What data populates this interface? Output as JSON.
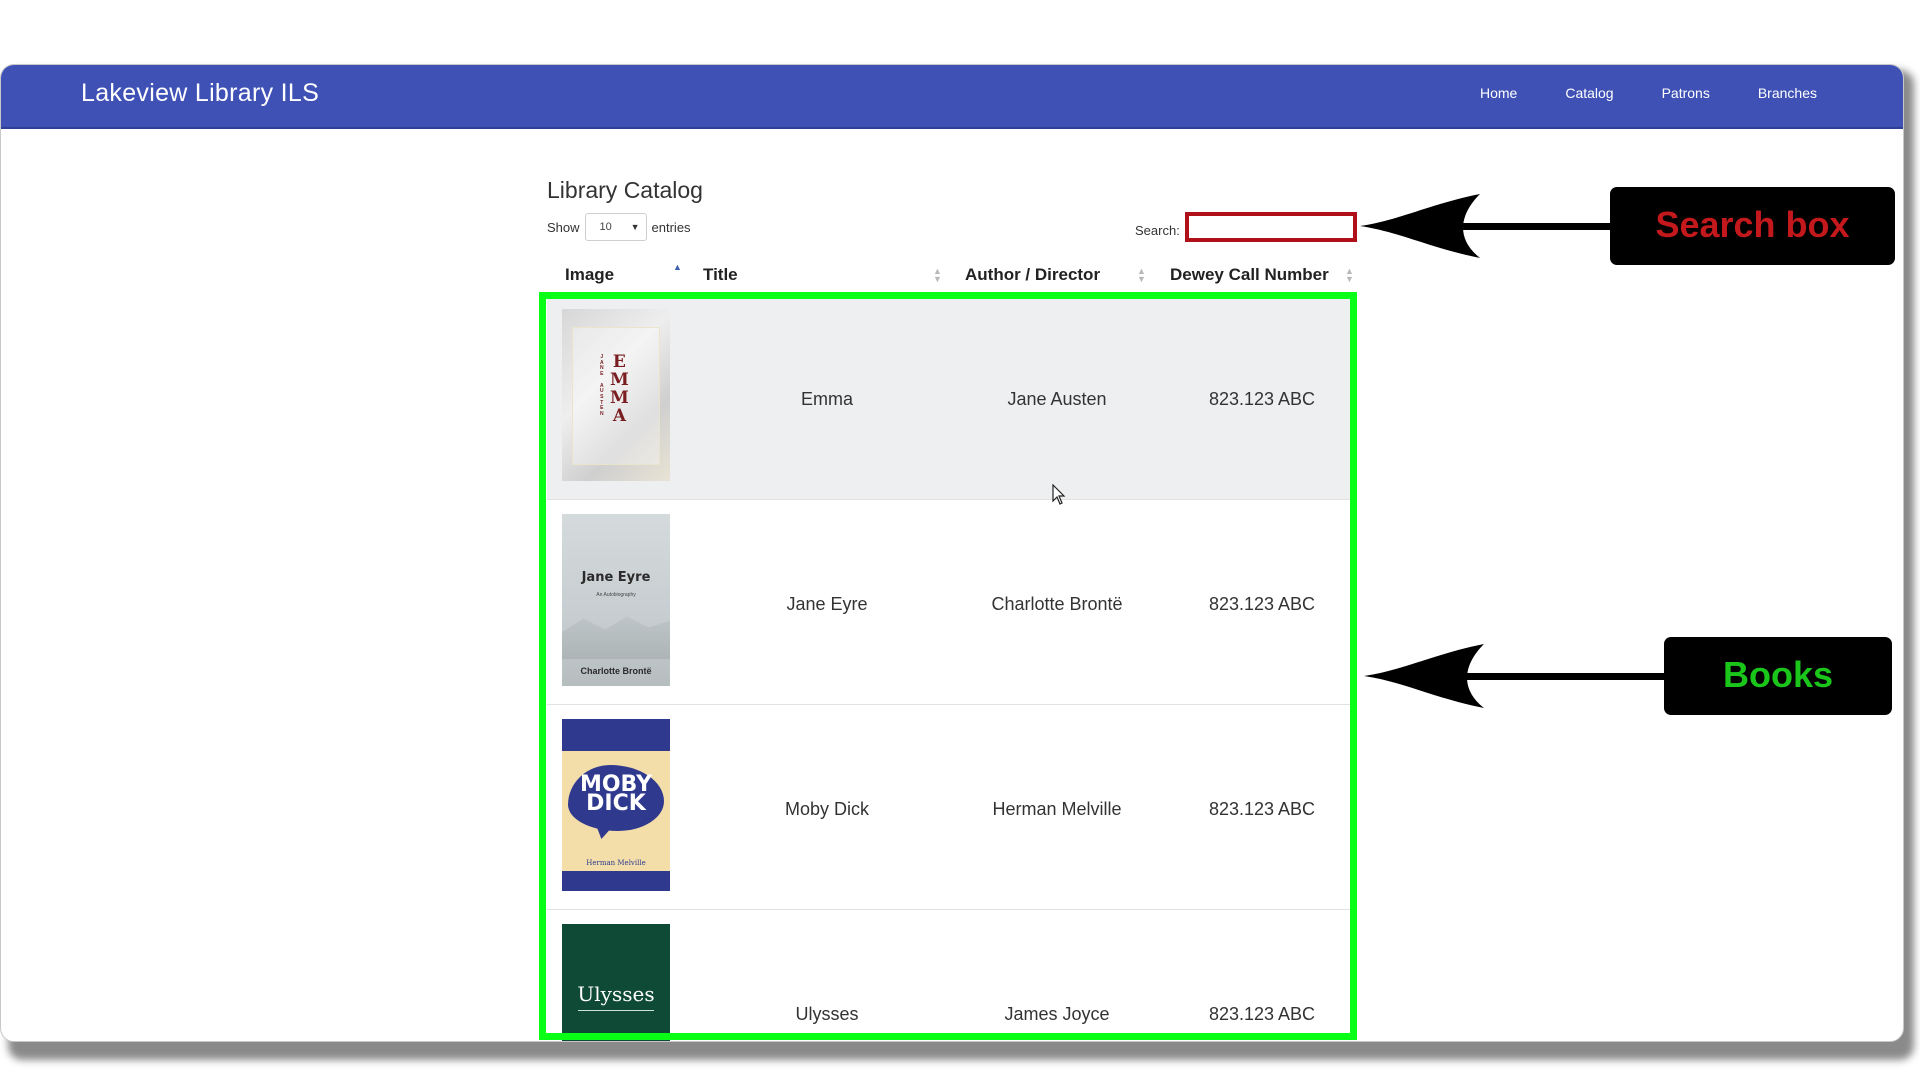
{
  "navbar": {
    "brand": "Lakeview Library ILS",
    "links": [
      "Home",
      "Catalog",
      "Patrons",
      "Branches"
    ]
  },
  "catalog": {
    "title": "Library Catalog",
    "show_label": "Show",
    "entries_value": "10",
    "entries_label": "entries",
    "search_label": "Search:",
    "search_value": ""
  },
  "table": {
    "headers": [
      "Image",
      "Title",
      "Author / Director",
      "Dewey Call Number"
    ],
    "rows": [
      {
        "cover": "EMMA",
        "cover_author": "JANE AUSTEN",
        "title": "Emma",
        "author": "Jane Austen",
        "dewey": "823.123 ABC"
      },
      {
        "cover": "Jane Eyre",
        "cover_subtitle": "An Autobiography",
        "cover_author": "Charlotte Brontë",
        "title": "Jane Eyre",
        "author": "Charlotte Brontë",
        "dewey": "823.123 ABC"
      },
      {
        "cover": "MOBY DICK",
        "cover_author": "Herman Melville",
        "title": "Moby Dick",
        "author": "Herman Melville",
        "dewey": "823.123 ABC"
      },
      {
        "cover": "Ulysses",
        "title": "Ulysses",
        "author": "James Joyce",
        "dewey": "823.123 ABC"
      }
    ]
  },
  "annotations": {
    "search_box": "Search box",
    "books": "Books",
    "search_color": "#c3181c",
    "books_color": "#1bc61b",
    "highlight_green": "#0aff16"
  }
}
